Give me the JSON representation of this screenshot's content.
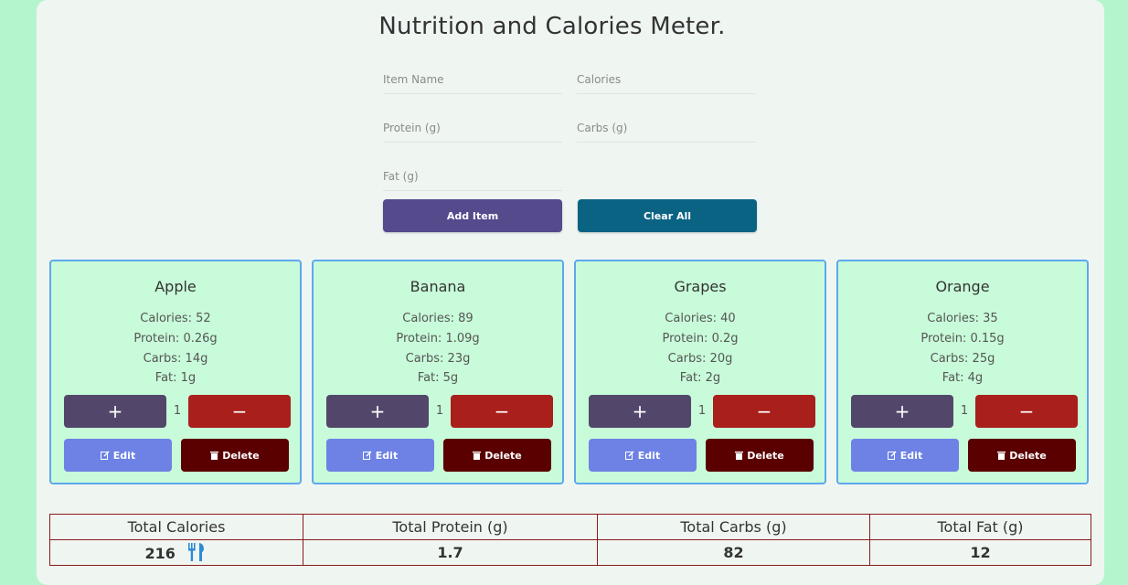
{
  "title": "Nutrition and Calories Meter.",
  "form": {
    "item_name_placeholder": "Item Name",
    "calories_placeholder": "Calories",
    "protein_placeholder": "Protein (g)",
    "carbs_placeholder": "Carbs (g)",
    "fat_placeholder": "Fat (g)",
    "add_label": "Add Item",
    "clear_label": "Clear All"
  },
  "colors": {
    "add_button": "#554a8c",
    "clear_button": "#0b6384",
    "card_bg": "#c8fbd9",
    "card_border": "#5ea7ee"
  },
  "items": [
    {
      "name": "Apple",
      "calories": "Calories: 52",
      "protein": "Protein: 0.26g",
      "carbs": "Carbs: 14g",
      "fat": "Fat: 1g",
      "qty": "1",
      "plus": "+",
      "minus": "−",
      "edit": "Edit",
      "delete": "Delete"
    },
    {
      "name": "Banana",
      "calories": "Calories: 89",
      "protein": "Protein: 1.09g",
      "carbs": "Carbs: 23g",
      "fat": "Fat: 5g",
      "qty": "1",
      "plus": "+",
      "minus": "−",
      "edit": "Edit",
      "delete": "Delete"
    },
    {
      "name": "Grapes",
      "calories": "Calories: 40",
      "protein": "Protein: 0.2g",
      "carbs": "Carbs: 20g",
      "fat": "Fat: 2g",
      "qty": "1",
      "plus": "+",
      "minus": "−",
      "edit": "Edit",
      "delete": "Delete"
    },
    {
      "name": "Orange",
      "calories": "Calories: 35",
      "protein": "Protein: 0.15g",
      "carbs": "Carbs: 25g",
      "fat": "Fat: 4g",
      "qty": "1",
      "plus": "+",
      "minus": "−",
      "edit": "Edit",
      "delete": "Delete"
    }
  ],
  "totals": {
    "headers": [
      "Total Calories",
      "Total Protein (g)",
      "Total Carbs (g)",
      "Total Fat (g)"
    ],
    "values": [
      "216",
      "1.7",
      "82",
      "12"
    ],
    "calories_icon": "utensils-icon"
  }
}
